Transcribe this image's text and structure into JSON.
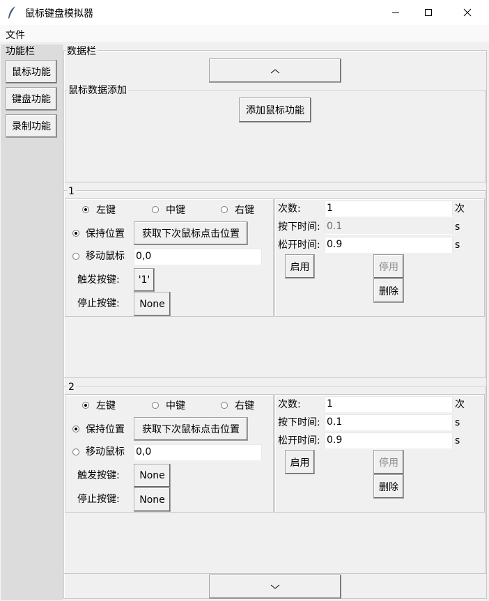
{
  "window": {
    "title": "鼠标键盘模拟器"
  },
  "menu": {
    "file": "文件"
  },
  "sidebar": {
    "title": "功能栏",
    "buttons": [
      "鼠标功能",
      "键盘功能",
      "录制功能"
    ]
  },
  "data_panel": {
    "title": "数据栏",
    "add_section_title": "鼠标数据添加",
    "add_button": "添加鼠标功能"
  },
  "items": [
    {
      "id": "1",
      "buttons": {
        "left": "左键",
        "middle": "中键",
        "right": "右键",
        "selected": "左键"
      },
      "position_mode": {
        "keep": "保持位置",
        "move": "移动鼠标",
        "selected": "保持位置"
      },
      "get_position_button": "获取下次鼠标点击位置",
      "move_coords": "0,0",
      "trigger_label": "触发按键:",
      "trigger_value": "'1'",
      "stop_label": "停止按键:",
      "stop_value": "None",
      "count_label": "次数:",
      "count_value": "1",
      "count_unit": "次",
      "press_label": "按下时间:",
      "press_value": "0.1",
      "press_unit": "s",
      "release_label": "松开时间:",
      "release_value": "0.9",
      "release_unit": "s",
      "enable_button": "启用",
      "disable_button": "停用",
      "delete_button": "删除"
    },
    {
      "id": "2",
      "buttons": {
        "left": "左键",
        "middle": "中键",
        "right": "右键",
        "selected": "左键"
      },
      "position_mode": {
        "keep": "保持位置",
        "move": "移动鼠标",
        "selected": "保持位置"
      },
      "get_position_button": "获取下次鼠标点击位置",
      "move_coords": "0,0",
      "trigger_label": "触发按键:",
      "trigger_value": "None",
      "stop_label": "停止按键:",
      "stop_value": "None",
      "count_label": "次数:",
      "count_value": "1",
      "count_unit": "次",
      "press_label": "按下时间:",
      "press_value": "0.1",
      "press_unit": "s",
      "release_label": "松开时间:",
      "release_value": "0.9",
      "release_unit": "s",
      "enable_button": "启用",
      "disable_button": "停用",
      "delete_button": "删除"
    }
  ]
}
